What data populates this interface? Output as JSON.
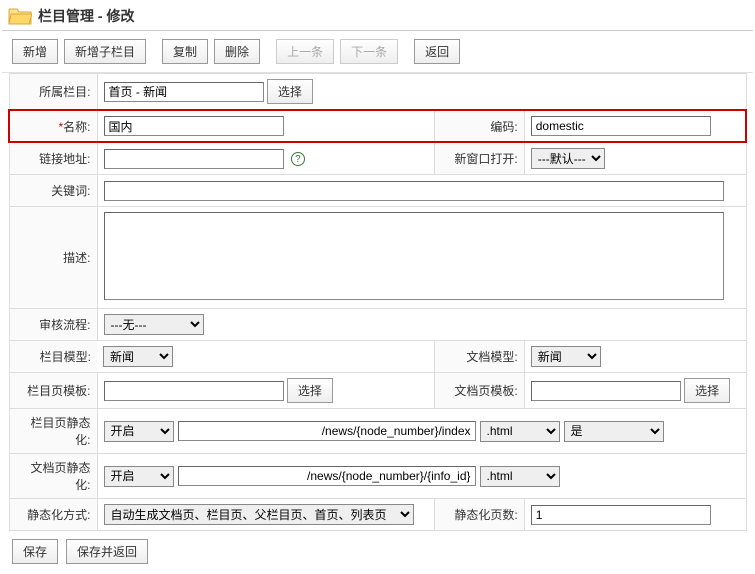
{
  "header": {
    "title": "栏目管理 - 修改"
  },
  "toolbar": {
    "new": "新增",
    "newSub": "新增子栏目",
    "copy": "复制",
    "delete": "删除",
    "prev": "上一条",
    "next": "下一条",
    "back": "返回"
  },
  "labels": {
    "parent": "所属栏目:",
    "name": "名称:",
    "code": "编码:",
    "link": "链接地址:",
    "newWin": "新窗口打开:",
    "keywords": "关键词:",
    "desc": "描述:",
    "audit": "审核流程:",
    "nodeModel": "栏目模型:",
    "docModel": "文档模型:",
    "nodeTpl": "栏目页模板:",
    "docTpl": "文档页模板:",
    "nodeStatic": "栏目页静态化:",
    "docStatic": "文档页静态化:",
    "staticMode": "静态化方式:",
    "staticPages": "静态化页数:",
    "choose": "选择"
  },
  "values": {
    "parent": "首页 - 新闻",
    "name": "国内",
    "code": "domestic",
    "link": "",
    "keywords": "",
    "desc": "",
    "nodeTpl": "",
    "docTpl": "",
    "nodePath": "/news/{node_number}/index",
    "docPath": "/news/{node_number}/{info_id}",
    "staticPages": "1"
  },
  "options": {
    "newWin": "---默认---",
    "audit": "---无---",
    "nodeModel": "新闻",
    "docModel": "新闻",
    "open": "开启",
    "ext": ".html",
    "yes": "是",
    "staticMode": "自动生成文档页、栏目页、父栏目页、首页、列表页"
  },
  "footer": {
    "save": "保存",
    "saveBack": "保存并返回"
  }
}
